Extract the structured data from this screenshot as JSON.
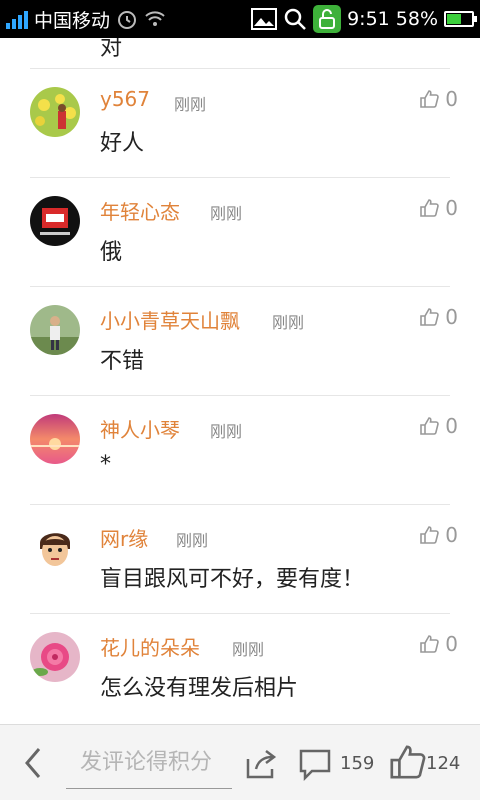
{
  "status_bar": {
    "carrier": "中国移动",
    "time": "9:51",
    "battery_percent": "58%",
    "battery_level": 0.58,
    "icons": [
      "signal-icon",
      "alarm-icon",
      "wifi-icon",
      "image-icon",
      "search-icon",
      "unlock-icon",
      "battery-icon"
    ]
  },
  "top_fragment": "对",
  "comments": [
    {
      "username": "y567",
      "time": "刚刚",
      "likes": "0",
      "text": "好人",
      "avatar": "flowers-avatar"
    },
    {
      "username": "年轻心态",
      "time": "刚刚",
      "likes": "0",
      "text": "俄",
      "avatar": "red-logo-avatar"
    },
    {
      "username": "小小青草天山飘",
      "time": "刚刚",
      "likes": "0",
      "text": "不错",
      "avatar": "person-avatar"
    },
    {
      "username": "神人小琴",
      "time": "刚刚",
      "likes": "0",
      "text": "*",
      "avatar": "sunset-avatar"
    },
    {
      "username": "网r缘",
      "time": "刚刚",
      "likes": "0",
      "text": "盲目跟风可不好，要有度！",
      "avatar": "cartoon-avatar"
    },
    {
      "username": "花儿的朵朵",
      "time": "刚刚",
      "likes": "0",
      "text": "怎么没有理发后相片",
      "avatar": "flower-avatar"
    }
  ],
  "bottom_bar": {
    "input_placeholder": "发评论得积分",
    "comment_count": "159",
    "like_count": "124"
  },
  "colors": {
    "username": "#e0833a",
    "accent_green": "#3eb13a"
  }
}
